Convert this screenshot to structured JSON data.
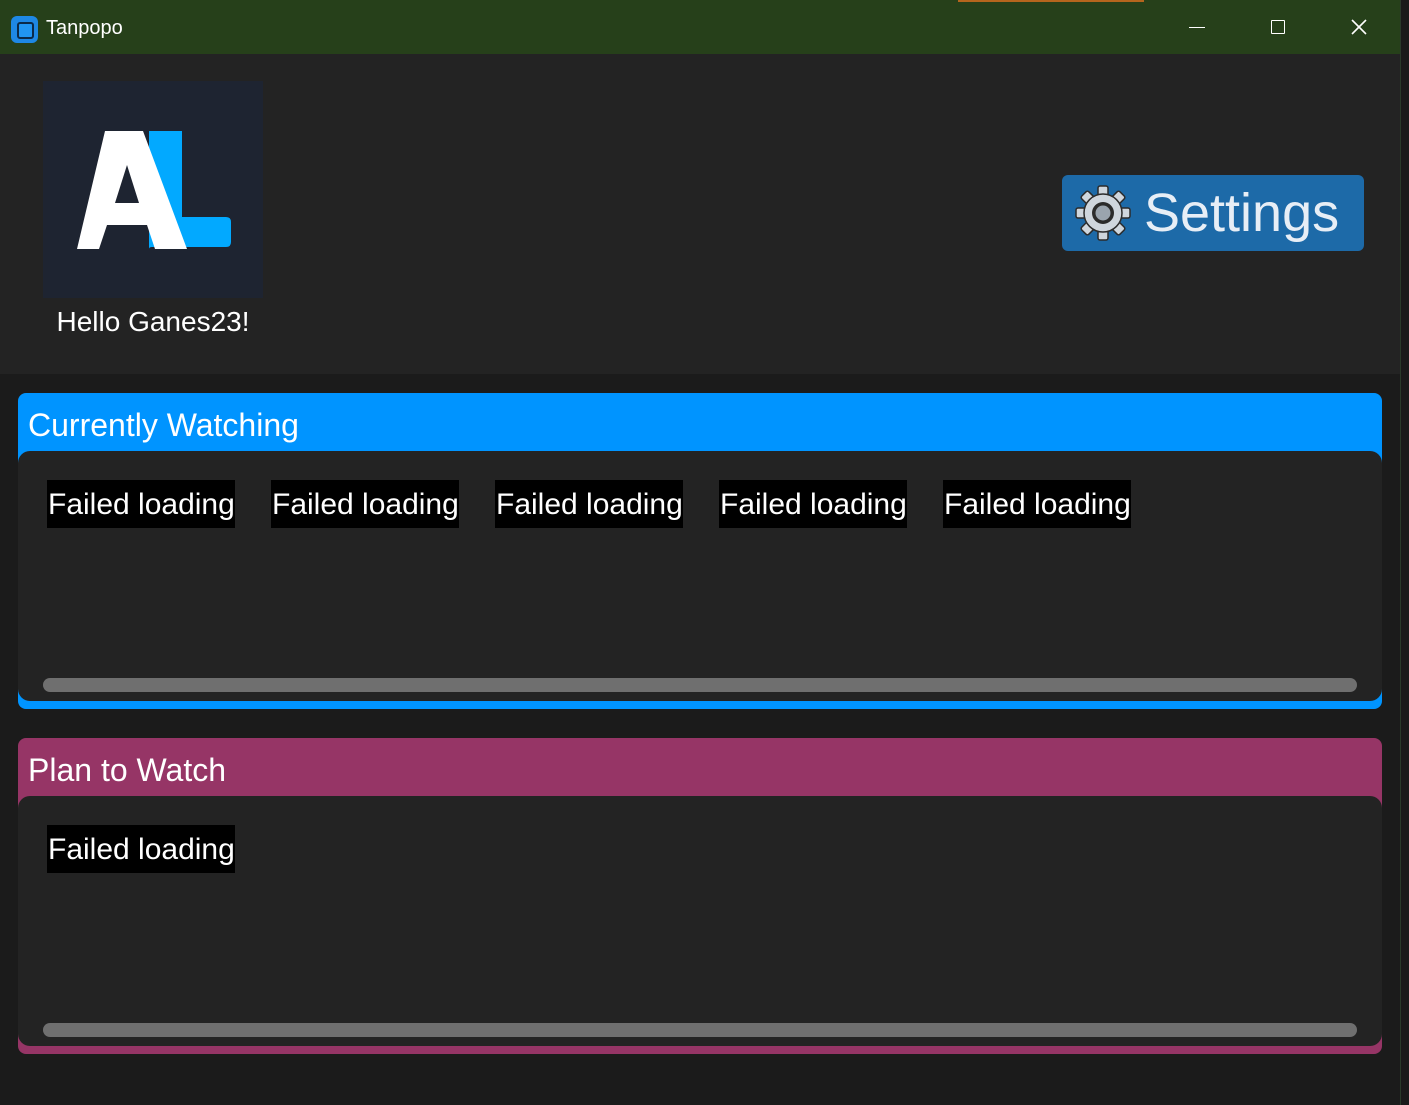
{
  "window": {
    "title": "Tanpopo",
    "controls": {
      "minimize_icon": "minimize-icon",
      "maximize_icon": "maximize-icon",
      "close_icon": "close-icon"
    }
  },
  "header": {
    "logo": "AL",
    "greeting": "Hello Ganes23!",
    "settings_label": "Settings",
    "settings_icon": "gear-icon"
  },
  "sections": [
    {
      "title": "Currently Watching",
      "color": "#0094ff",
      "items": [
        "Failed loading",
        "Failed loading",
        "Failed loading",
        "Failed loading",
        "Failed loading"
      ]
    },
    {
      "title": "Plan to Watch",
      "color": "#963566",
      "items": [
        "Failed loading"
      ]
    }
  ],
  "colors": {
    "titlebar": "#26401a",
    "settings_button": "#1d6aa8",
    "logo_background": "#1e2431",
    "logo_accent": "#02a9ff"
  }
}
